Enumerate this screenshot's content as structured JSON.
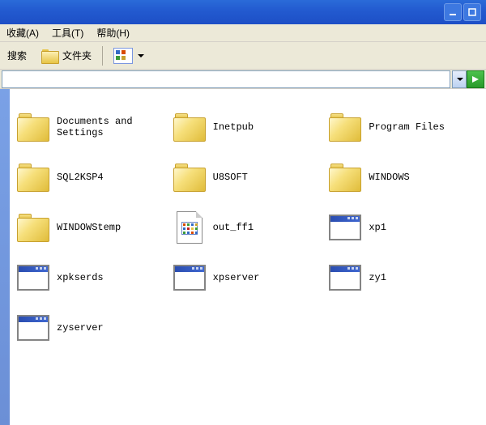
{
  "menu": {
    "favorites": "收藏(A)",
    "tools": "工具(T)",
    "help": "帮助(H)"
  },
  "toolbar": {
    "search": "搜索",
    "folders": "文件夹"
  },
  "items": [
    {
      "type": "folder",
      "label": "Documents and Settings"
    },
    {
      "type": "folder",
      "label": "Inetpub"
    },
    {
      "type": "folder",
      "label": "Program Files"
    },
    {
      "type": "folder",
      "label": "SQL2KSP4"
    },
    {
      "type": "folder",
      "label": "U8SOFT"
    },
    {
      "type": "folder",
      "label": "WINDOWS"
    },
    {
      "type": "folder",
      "label": "WINDOWStemp"
    },
    {
      "type": "file",
      "label": "out_ff1"
    },
    {
      "type": "app",
      "label": "xp1"
    },
    {
      "type": "app",
      "label": "xpkserds"
    },
    {
      "type": "app",
      "label": "xpserver"
    },
    {
      "type": "app",
      "label": "zy1"
    },
    {
      "type": "app",
      "label": "zyserver"
    }
  ]
}
